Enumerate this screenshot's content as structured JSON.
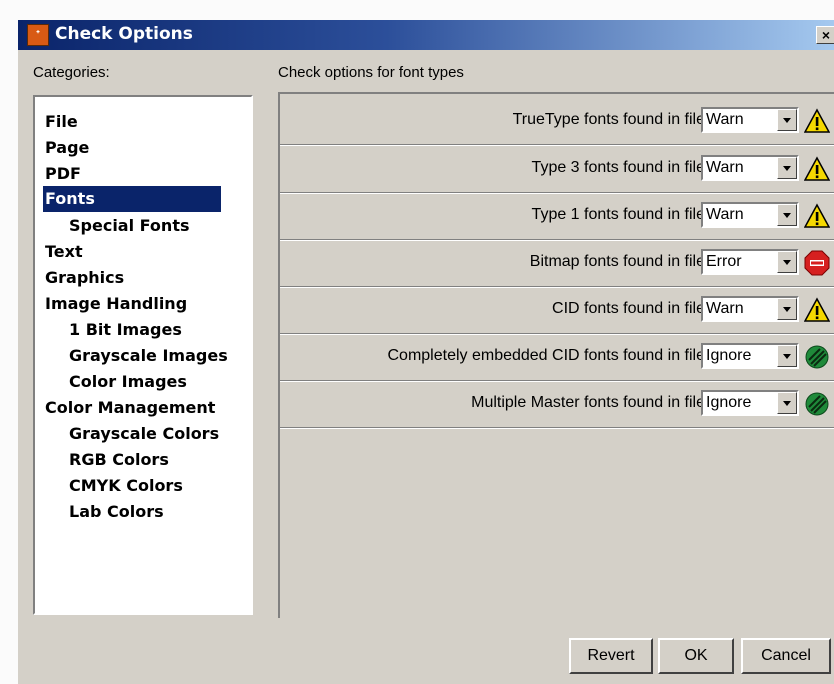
{
  "window": {
    "title": "Check Options",
    "close_label": "×"
  },
  "categories": {
    "label": "Categories:",
    "items": [
      {
        "label": "File",
        "indent": false
      },
      {
        "label": "Page",
        "indent": false
      },
      {
        "label": "PDF",
        "indent": false
      },
      {
        "label": "Fonts",
        "indent": false,
        "selected": true
      },
      {
        "label": "Special Fonts",
        "indent": true
      },
      {
        "label": "Text",
        "indent": false
      },
      {
        "label": "Graphics",
        "indent": false
      },
      {
        "label": "Image Handling",
        "indent": false
      },
      {
        "label": "1 Bit Images",
        "indent": true
      },
      {
        "label": "Grayscale Images",
        "indent": true
      },
      {
        "label": "Color Images",
        "indent": true
      },
      {
        "label": "Color Management",
        "indent": false
      },
      {
        "label": "Grayscale Colors",
        "indent": true
      },
      {
        "label": "RGB Colors",
        "indent": true
      },
      {
        "label": "CMYK Colors",
        "indent": true
      },
      {
        "label": "Lab Colors",
        "indent": true
      }
    ]
  },
  "options": {
    "heading": "Check options for font types",
    "rows": [
      {
        "label": "TrueType fonts found in file",
        "value": "Warn",
        "icon": "warning-icon"
      },
      {
        "label": "Type 3 fonts found in file",
        "value": "Warn",
        "icon": "warning-icon"
      },
      {
        "label": "Type 1 fonts found in file",
        "value": "Warn",
        "icon": "warning-icon"
      },
      {
        "label": "Bitmap fonts found in file",
        "value": "Error",
        "icon": "stop-icon"
      },
      {
        "label": "CID fonts found in file",
        "value": "Warn",
        "icon": "warning-icon"
      },
      {
        "label": "Completely embedded CID fonts found in file",
        "value": "Ignore",
        "icon": "ignore-icon"
      },
      {
        "label": "Multiple Master fonts found in file",
        "value": "Ignore",
        "icon": "ignore-icon"
      }
    ]
  },
  "buttons": {
    "revert": "Revert",
    "ok": "OK",
    "cancel": "Cancel"
  },
  "colors": {
    "window_bg": "#d4d0c8",
    "selection": "#0a246a",
    "warning": "#f5d800",
    "stop": "#d62020",
    "ignore": "#1f8a3a"
  }
}
